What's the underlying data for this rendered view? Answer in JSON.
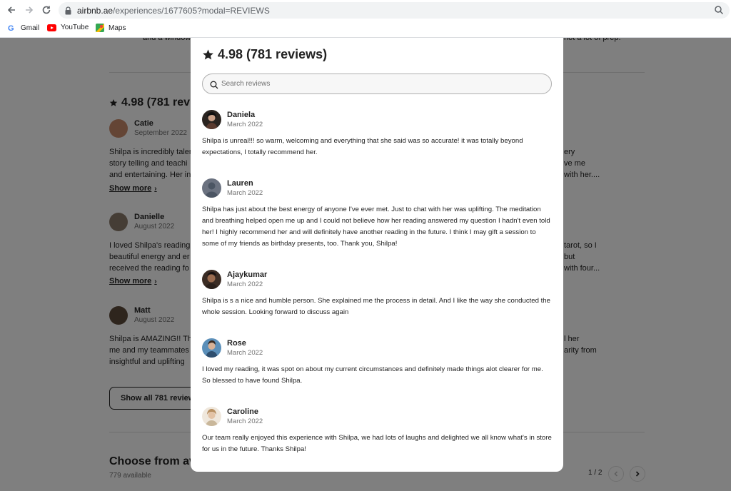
{
  "browser": {
    "url_host": "airbnb.ae",
    "url_path": "/experiences/1677605?modal=REVIEWS",
    "bookmarks": [
      {
        "label": "Gmail",
        "icon": "gmail-icon"
      },
      {
        "label": "YouTube",
        "icon": "youtube-icon"
      },
      {
        "label": "Maps",
        "icon": "maps-icon"
      }
    ]
  },
  "background": {
    "top_left_fragment": "and a window to",
    "top_right_fragment": "not a lot of prep.",
    "rating_text": "4.98 (781 revie",
    "reviews": [
      {
        "name": "Catie",
        "date": "September 2022",
        "lines": [
          "Shilpa is incredibly taler",
          "story telling and teachi",
          "and entertaining. Her in"
        ],
        "right_lines": [
          "ery",
          "ve me",
          "with her...."
        ]
      },
      {
        "name": "Danielle",
        "date": "August 2022",
        "lines": [
          "I loved Shilpa's reading",
          "beautiful energy and er",
          "received the reading fo"
        ],
        "right_lines": [
          "tarot, so I",
          "but",
          "with four..."
        ]
      },
      {
        "name": "Matt",
        "date": "August 2022",
        "lines": [
          "Shilpa is AMAZING!! Thi",
          "me and my teammates",
          "insightful and uplifting"
        ],
        "right_lines": [
          "l her",
          "arity from",
          ""
        ]
      }
    ],
    "show_more_label": "Show more",
    "show_all_label": "Show all 781 reviews",
    "choose_label": "Choose from ava",
    "available_label": "779 available",
    "pager_label": "1 / 2"
  },
  "modal": {
    "rating_text": "4.98 (781 reviews)",
    "search_placeholder": "Search reviews",
    "reviews": [
      {
        "name": "Daniela",
        "date": "March 2022",
        "text": "Shilpa is unreal!!! so warm, welcoming and everything that she said was so accurate! it was totally beyond expectations, I totally recommend her."
      },
      {
        "name": "Lauren",
        "date": "March 2022",
        "text": "Shilpa has just about the best energy of anyone I've ever met. Just to chat with her was uplifting. The meditation and breathing helped open me up and I could not believe how her reading answered my question I hadn't even told her! I highly recommend her and will definitely have another reading in the future. I think I may gift a session to some of my friends as birthday presents, too. Thank you, Shilpa!"
      },
      {
        "name": "Ajaykumar",
        "date": "March 2022",
        "text": "Shilpa is s a nice and humble person. She explained me the process in detail. And I like the way she conducted the whole session. Looking forward to discuss again"
      },
      {
        "name": "Rose",
        "date": "March 2022",
        "text": "I loved my reading, it was spot on about my current circumstances and definitely made things alot clearer for me. So blessed to have found Shilpa."
      },
      {
        "name": "Caroline",
        "date": "March 2022",
        "text": "Our team really enjoyed this experience with Shilpa, we had lots of laughs and delighted we all know what's in store for us in the future. Thanks Shilpa!"
      }
    ]
  }
}
